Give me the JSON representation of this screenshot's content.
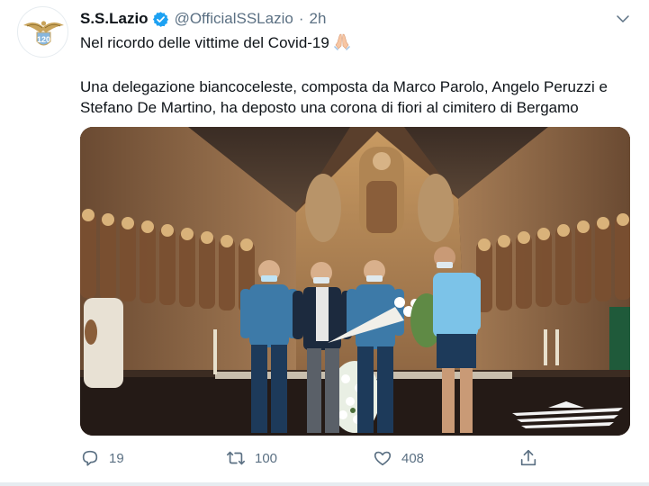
{
  "tweet": {
    "display_name": "S.S.Lazio",
    "handle": "@OfficialSSLazio",
    "separator": "·",
    "time": "2h",
    "line1": "Nel ricordo delle vittime del Covid-19",
    "line2": "Una delegazione biancoceleste, composta da Marco Parolo, Angelo Peruzzi e",
    "line3": "Stefano De Martino, ha deposto una corona di fiori al cimitero di Bergamo",
    "emoji": "folded-hands-emoji"
  },
  "avatar": {
    "badge_number": "120",
    "icon": "lazio-eagle-crest-icon"
  },
  "actions": {
    "replies": "19",
    "retweets": "100",
    "likes": "408"
  },
  "colors": {
    "text": "#0f1419",
    "muted": "#5b7083",
    "verified": "#1da1f2",
    "lazio_blue": "#87b6dd"
  }
}
